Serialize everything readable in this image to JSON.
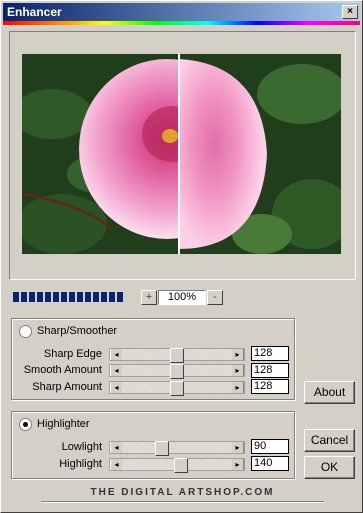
{
  "window": {
    "title": "Enhancer",
    "close_glyph": "×"
  },
  "zoom": {
    "minus": "-",
    "plus": "+",
    "value": "100%"
  },
  "progress": {
    "segments": 14
  },
  "sharp_group": {
    "radio_label": "Sharp/Smoother",
    "selected": false,
    "sliders": [
      {
        "label": "Sharp Edge",
        "value": "128"
      },
      {
        "label": "Smooth Amount",
        "value": "128"
      },
      {
        "label": "Sharp Amount",
        "value": "128"
      }
    ]
  },
  "highlight_group": {
    "radio_label": "Highlighter",
    "selected": true,
    "sliders": [
      {
        "label": "Lowlight",
        "value": "90"
      },
      {
        "label": "Highlight",
        "value": "140"
      }
    ]
  },
  "buttons": {
    "about": "About",
    "cancel": "Cancel",
    "ok": "OK"
  },
  "footer": "THE DIGITAL ARTSHOP.COM",
  "slider_arrows": {
    "left": "◂",
    "right": "▸"
  }
}
